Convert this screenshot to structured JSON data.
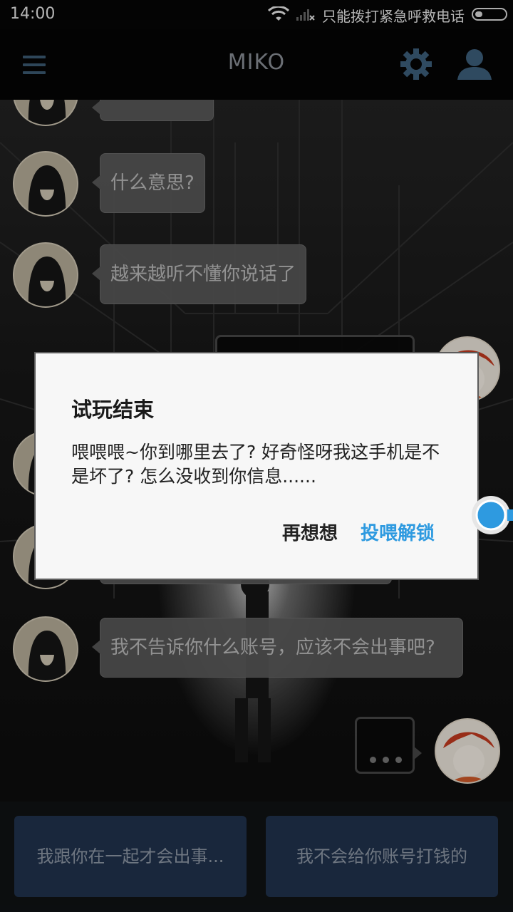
{
  "status_bar": {
    "time": "14:00",
    "carrier": "只能拨打紧急呼救电话",
    "battery_level": 0.25
  },
  "app_bar": {
    "title": "MIKO",
    "menu_icon": "hamburger-menu-icon",
    "settings_icon": "gear-icon",
    "profile_icon": "user-icon"
  },
  "chat": {
    "messages": [
      {
        "side": "left",
        "text": "",
        "partial": true
      },
      {
        "side": "left",
        "text": "什么意思?"
      },
      {
        "side": "left",
        "text": "越来越听不懂你说话了"
      },
      {
        "side": "right",
        "text": ""
      },
      {
        "side": "left",
        "text": ""
      },
      {
        "side": "left",
        "text": ""
      },
      {
        "side": "left",
        "text": "我不告诉你什么账号，应该不会出事吧?"
      },
      {
        "side": "right",
        "typing": true
      }
    ]
  },
  "options": {
    "option_1": "我跟你在一起才会出事...",
    "option_2": "我不会给你账号打钱的"
  },
  "dialog": {
    "title": "试玩结束",
    "message": "喂喂喂~你到哪里去了? 好奇怪呀我这手机是不是坏了? 怎么没收到你信息......",
    "cancel_label": "再想想",
    "confirm_label": "投喂解锁",
    "confirm_color": "#2e9ae0"
  }
}
